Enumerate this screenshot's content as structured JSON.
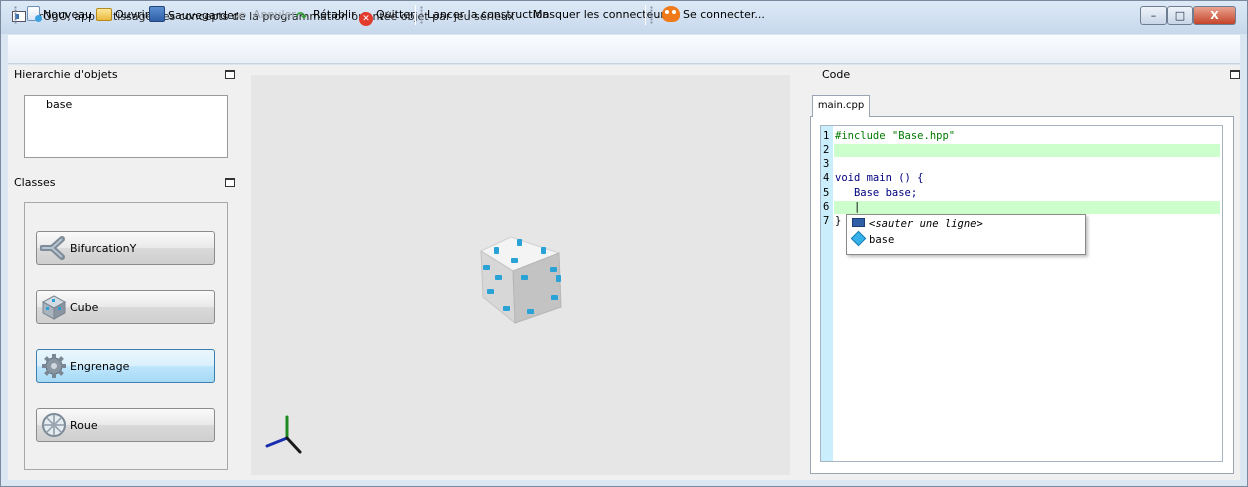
{
  "window": {
    "title": "PrOgO, apprentissage des concepts de la programmation orientée objet par jeu sérieux",
    "controls": {
      "minimize": "–",
      "maximize": "□",
      "close": "X"
    }
  },
  "toolbar": {
    "new_label": "Nouveau",
    "open_label": "Ouvrir",
    "save_label": "Sauvegarder",
    "undo_label": "Annuler",
    "redo_label": "Rétablir",
    "quit_label": "Quitter",
    "build_label": "Lancer la construction",
    "hide_connectors_label": "Masquer les connecteurs",
    "connect_label": "Se connecter..."
  },
  "hierarchy": {
    "title": "Hierarchie d'objets",
    "items": [
      "base"
    ]
  },
  "classes": {
    "title": "Classes",
    "items": [
      {
        "label": "BifurcationY",
        "icon": "pipe-y-icon",
        "active": false
      },
      {
        "label": "Cube",
        "icon": "cube-icon",
        "active": false
      },
      {
        "label": "Engrenage",
        "icon": "gear-icon",
        "active": true
      },
      {
        "label": "Roue",
        "icon": "wheel-icon",
        "active": false
      }
    ]
  },
  "code": {
    "title": "Code",
    "tab": "main.cpp",
    "lines": [
      {
        "num": "1",
        "text": "#include \"Base.hpp\""
      },
      {
        "num": "2",
        "text": ""
      },
      {
        "num": "3",
        "text": ""
      },
      {
        "num": "4",
        "text": "void main () {"
      },
      {
        "num": "5",
        "text": "   Base base;"
      },
      {
        "num": "6",
        "text": "   |"
      },
      {
        "num": "7",
        "text": "}"
      }
    ],
    "autocomplete": [
      {
        "text": "<sauter une ligne>",
        "icon": "keyboard-icon"
      },
      {
        "text": "base",
        "icon": "object-icon"
      }
    ]
  },
  "colors": {
    "accent": "#3c7fb1",
    "highlight_line": "#ccffcc",
    "gutter": "#cbeefc",
    "connector": "#29a3d6",
    "include_text": "#007a00",
    "keyword": "#00007f"
  }
}
